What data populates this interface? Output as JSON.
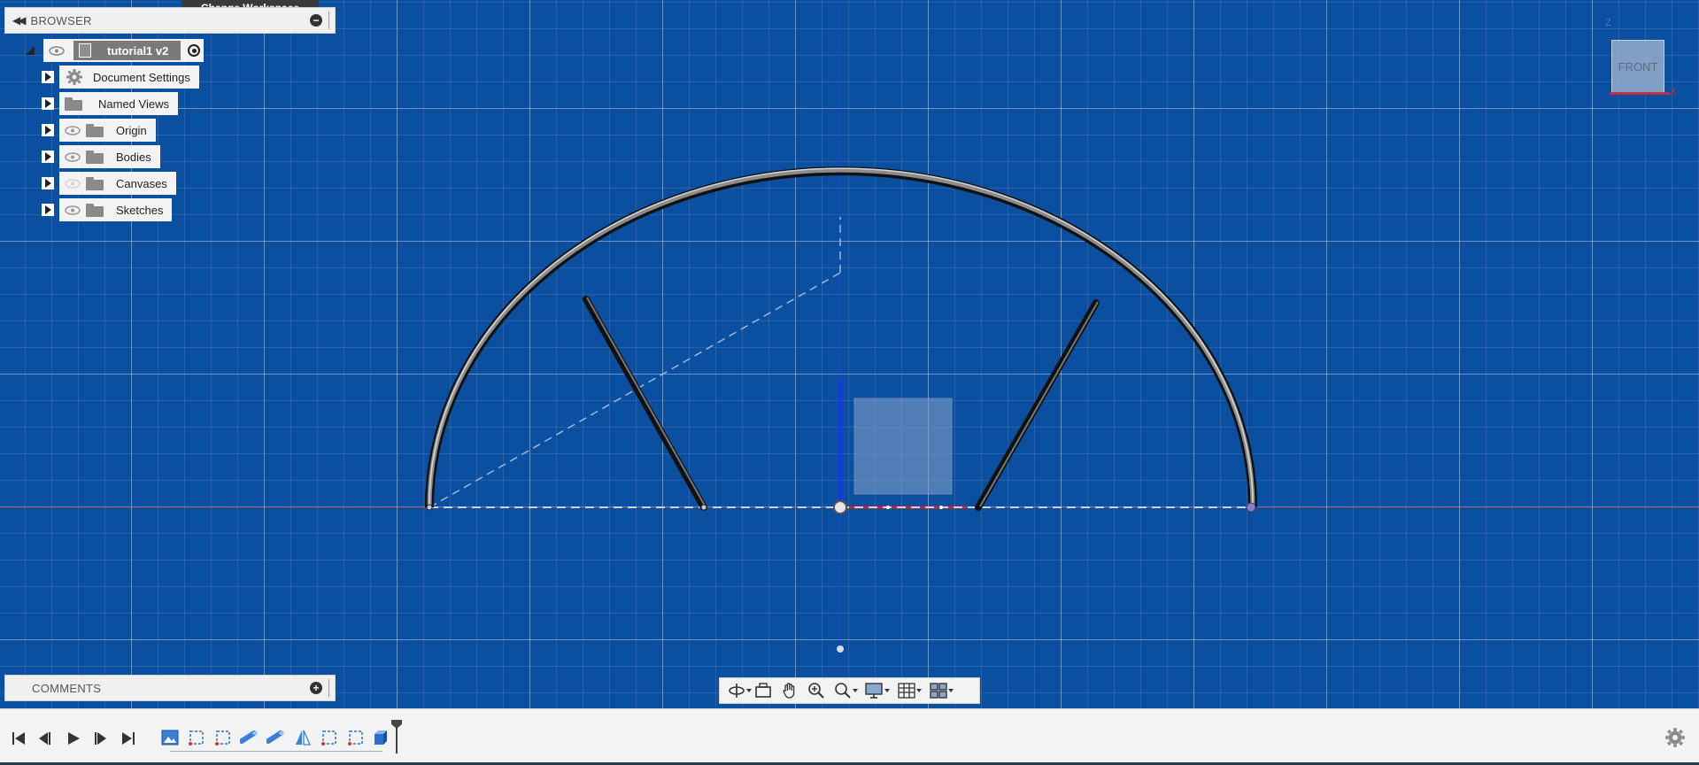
{
  "workspace_tooltip": "Change Workspace",
  "browser": {
    "title": "BROWSER",
    "root": {
      "name": "tutorial1 v2"
    },
    "items": [
      {
        "label": "Document Settings",
        "icon": "gear-icon"
      },
      {
        "label": "Named Views",
        "icon": "folder-icon"
      },
      {
        "label": "Origin",
        "icon": "folder-icon"
      },
      {
        "label": "Bodies",
        "icon": "folder-icon"
      },
      {
        "label": "Canvases",
        "icon": "folder-icon"
      },
      {
        "label": "Sketches",
        "icon": "folder-icon"
      }
    ]
  },
  "comments": {
    "title": "COMMENTS"
  },
  "viewcube": {
    "face": "FRONT",
    "axis_z": "Z",
    "axis_x": "X"
  },
  "nav_toolbar": {
    "tools": [
      "orbit-icon",
      "look-at-icon",
      "pan-icon",
      "zoom-icon",
      "fit-icon",
      "display-settings-icon",
      "grid-settings-icon",
      "viewports-icon"
    ]
  },
  "timeline": {
    "playback": [
      "skip-to-start-icon",
      "step-back-icon",
      "play-icon",
      "step-forward-icon",
      "skip-to-end-icon"
    ],
    "features": [
      "canvas-icon",
      "sketch-icon",
      "sketch-icon",
      "pipe-icon",
      "pipe-icon",
      "mirror-icon",
      "sketch-icon",
      "sketch-icon",
      "body-icon"
    ]
  },
  "colors": {
    "canvas_bg": "#0b4fa1",
    "x_axis": "#d41e2a",
    "z_axis": "#1f2bff",
    "panel_bg": "#f3f3f3"
  }
}
